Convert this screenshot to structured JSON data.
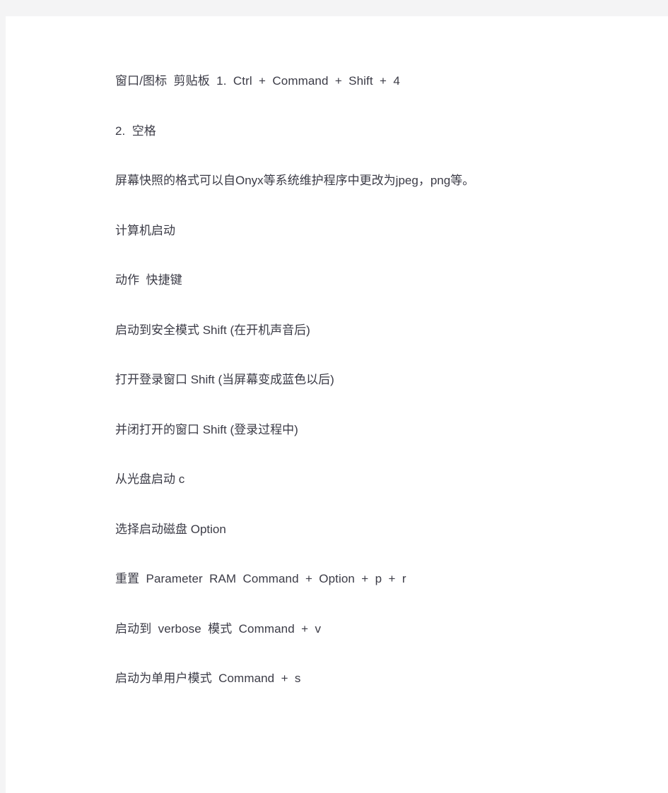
{
  "page": {
    "background_color": "#f4f4f5",
    "sheet_color": "#ffffff",
    "text_color": "#3b3b46"
  },
  "document": {
    "paragraphs": [
      {
        "id": "shortcut-window-icon-clipboard",
        "text": "窗口/图标 剪贴板 1. Ctrl + Command + Shift + 4",
        "style": "spaced"
      },
      {
        "id": "step-two-space",
        "text": "2. 空格",
        "style": "spaced"
      },
      {
        "id": "note-screenshot-format",
        "text": "屏幕快照的格式可以自Onyx等系统维护程序中更改为jpeg，png等。",
        "style": "tight"
      },
      {
        "id": "section-heading-startup",
        "text": "计算机启动",
        "style": "tight"
      },
      {
        "id": "table-header-action-shortcut",
        "text": "动作 快捷键",
        "style": "spaced"
      },
      {
        "id": "row-safe-mode",
        "text": "启动到安全模式 Shift (在开机声音后)",
        "style": "tight"
      },
      {
        "id": "row-login-window",
        "text": "打开登录窗口 Shift (当屏幕变成蓝色以后)",
        "style": "tight"
      },
      {
        "id": "row-close-open-windows",
        "text": "并闭打开的窗口 Shift (登录过程中)",
        "style": "tight"
      },
      {
        "id": "row-boot-from-disc",
        "text": "从光盘启动 c",
        "style": "tight"
      },
      {
        "id": "row-select-startup-disk",
        "text": "选择启动磁盘 Option",
        "style": "tight"
      },
      {
        "id": "row-reset-pram",
        "text": "重置 Parameter RAM Command + Option + p + r",
        "style": "spaced"
      },
      {
        "id": "row-verbose-mode",
        "text": "启动到 verbose 模式 Command + v",
        "style": "spaced"
      },
      {
        "id": "row-single-user-mode",
        "text": "启动为单用户模式 Command + s",
        "style": "spaced"
      }
    ]
  }
}
